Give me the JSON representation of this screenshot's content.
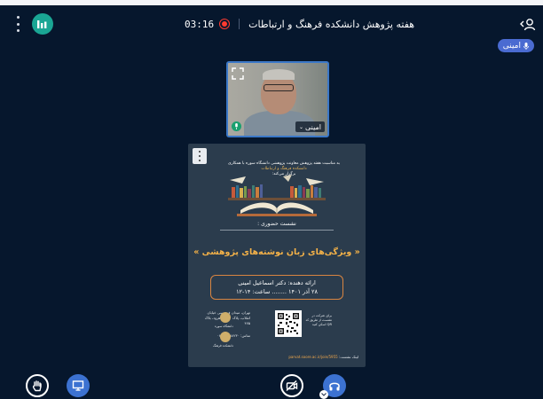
{
  "header": {
    "timer": "03:16",
    "meeting_title": "هفته پژوهش دانشکده فرهنگ و ارتباطات"
  },
  "speaker_badge": {
    "name": "امینی"
  },
  "video_tile": {
    "name": "امینی"
  },
  "poster": {
    "intro_line1": "به مناسبت هفته پژوهش معاونت پژوهشی دانشگاه سوره با همکاری",
    "intro_line2": "دانشکده فرهنگ و ارتباطات",
    "intro_line3": "برگزار می‌کند:",
    "session_label": "نشست حضوری :",
    "topic": "« ویژگی‌های زبان نوشته‌های پژوهشی »",
    "presenter": "ارائه دهنده: دکتر اسماعیل امینی",
    "date_time": "۲۸ آذر ۱۴۰۱ ........ ساعت: ۱۴-۱۲",
    "address": "تهران، میدان فردوسی خیابان انقلاب، پلاک ۷۵۰ شاهرود، بلاک ۴۷۵",
    "phone": "تماس: ۶۶۴۸۸۲۳۰-۰۲۱",
    "qr_text": "برای شرکت در نشست از طریق کد QR اسکن کنید",
    "logo1": "دانشگاه سوره",
    "logo2": "دانشکده فرهنگ",
    "link_label": "لینک نشست:",
    "link": "parvat.soore.ac.ir/join/5955"
  }
}
